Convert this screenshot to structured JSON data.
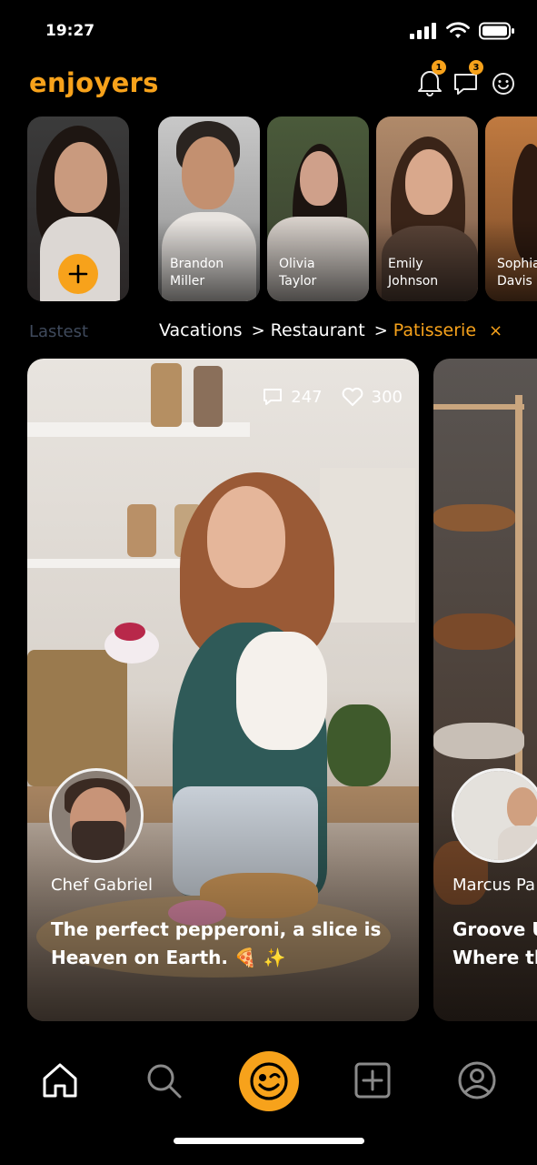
{
  "status_bar": {
    "time": "19:27"
  },
  "app": {
    "title": "enjoyers",
    "accent_color": "#F7A21B"
  },
  "header": {
    "notifications_badge": "1",
    "messages_badge": "3",
    "icons": [
      "bell-icon",
      "chat-icon",
      "smiley-icon"
    ]
  },
  "stories": [
    {
      "first": "",
      "last": "",
      "is_own": true,
      "action_icon": "plus-icon"
    },
    {
      "first": "Brandon",
      "last": "Miller"
    },
    {
      "first": "Olivia",
      "last": "Taylor"
    },
    {
      "first": "Emily",
      "last": "Johnson"
    },
    {
      "first": "Sophia",
      "last": "Davis"
    }
  ],
  "filters": {
    "latest": "Lastest",
    "breadcrumb": [
      "Vacations",
      "Restaurant",
      "Patisserie"
    ],
    "separator": ">",
    "clear": "×"
  },
  "posts": [
    {
      "comments": "247",
      "likes": "300",
      "author": "Chef Gabriel",
      "caption_line1": "The perfect pepperoni, a slice is",
      "caption_line2": "Heaven on Earth. 🍕 ✨"
    },
    {
      "author": "Marcus Pa",
      "caption_line1": "Groove U",
      "caption_line2": "Where th"
    }
  ],
  "bottom_nav": [
    "home-icon",
    "search-icon",
    "enjoyers-icon",
    "add-post-icon",
    "profile-icon"
  ]
}
